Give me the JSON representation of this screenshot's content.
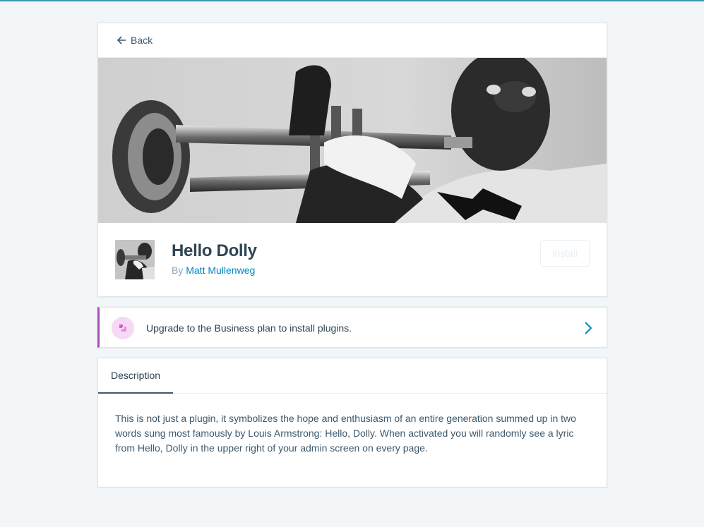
{
  "header": {
    "back_label": "Back"
  },
  "plugin": {
    "name": "Hello Dolly",
    "by_prefix": "By",
    "author": "Matt Mullenweg",
    "install_label": "Install"
  },
  "nudge": {
    "text": "Upgrade to the Business plan to install plugins.",
    "accent_color": "#a64fb5"
  },
  "tabs": [
    {
      "label": "Description",
      "active": true
    }
  ],
  "description": "This is not just a plugin, it symbolizes the hope and enthusiasm of an entire generation summed up in two words sung most famously by Louis Armstrong: Hello, Dolly. When activated you will randomly see a lyric from Hello, Dolly in the upper right of your admin screen on every page.",
  "icons": {
    "back": "arrow-left-icon",
    "nudge": "business-plan-icon",
    "chevron": "chevron-right-icon"
  }
}
